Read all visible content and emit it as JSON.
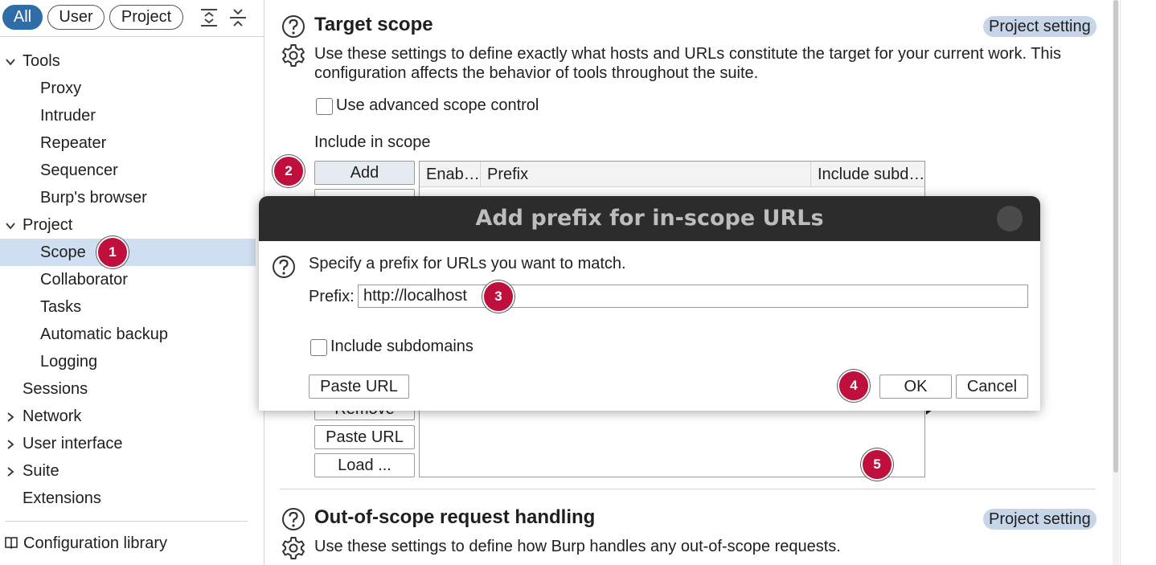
{
  "filters": {
    "all": "All",
    "user": "User",
    "project": "Project"
  },
  "sidebar": {
    "items": [
      {
        "label": "Tools",
        "chevron": "down"
      },
      {
        "label": "Proxy"
      },
      {
        "label": "Intruder"
      },
      {
        "label": "Repeater"
      },
      {
        "label": "Sequencer"
      },
      {
        "label": "Burp's browser"
      },
      {
        "label": "Project",
        "chevron": "down"
      },
      {
        "label": "Scope",
        "selected": true
      },
      {
        "label": "Collaborator"
      },
      {
        "label": "Tasks"
      },
      {
        "label": "Automatic backup"
      },
      {
        "label": "Logging"
      },
      {
        "label": "Sessions"
      },
      {
        "label": "Network",
        "chevron": "right"
      },
      {
        "label": "User interface",
        "chevron": "right"
      },
      {
        "label": "Suite",
        "chevron": "right"
      },
      {
        "label": "Extensions"
      }
    ],
    "library": "Configuration library"
  },
  "target_scope": {
    "title": "Target scope",
    "badge": "Project setting",
    "description": "Use these settings to define exactly what hosts and URLs constitute the target for your current work. This configuration affects the behavior of tools throughout the suite.",
    "advanced_label": "Use advanced scope control",
    "include_label": "Include in scope",
    "buttons": {
      "add": "Add",
      "remove": "Remove",
      "paste_url": "Paste URL",
      "load": "Load ..."
    },
    "table_headers": [
      "Enab…",
      "Prefix",
      "Include subd…"
    ]
  },
  "out_of_scope": {
    "title": "Out-of-scope request handling",
    "badge": "Project setting",
    "description": "Use these settings to define how Burp handles any out-of-scope requests."
  },
  "dialog": {
    "title": "Add prefix for in-scope URLs",
    "instruction": "Specify a prefix for URLs you want to match.",
    "prefix_label": "Prefix:",
    "prefix_value": "http://localhost",
    "subdomains_label": "Include subdomains",
    "paste_url": "Paste URL",
    "ok": "OK",
    "cancel": "Cancel"
  },
  "annotations": [
    "1",
    "2",
    "3",
    "4",
    "5"
  ],
  "colors": {
    "accent": "#2f6da8",
    "badge": "#bf0f3c",
    "selection": "#cfdff1",
    "project_pill": "#c6d6e8",
    "dialog_titlebar": "#2c2c2c"
  }
}
